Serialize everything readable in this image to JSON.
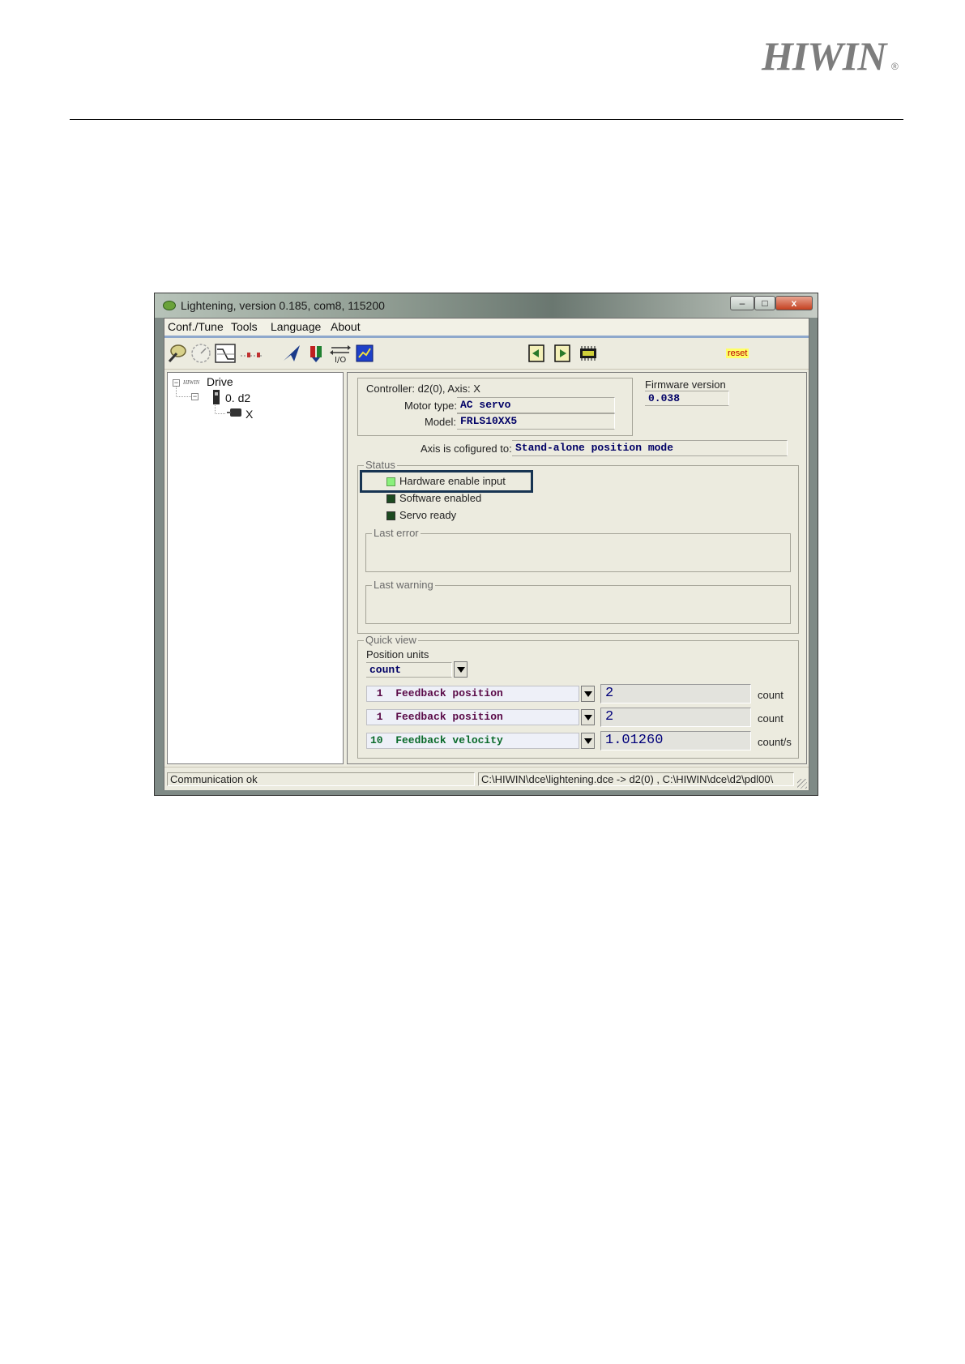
{
  "page": {
    "brand": "HIWIN",
    "registered_mark": "®"
  },
  "window": {
    "title": "Lightening, version 0.185, com8, 115200",
    "buttons": {
      "minimize": "–",
      "maximize": "□",
      "close": "x"
    },
    "menu": [
      "Conf./Tune",
      "Tools",
      "Language",
      "About"
    ],
    "toolbar": {
      "reset_label": "reset",
      "icons": [
        "wrench-icon",
        "scope-icon",
        "profile-icon",
        "io-signals-icon",
        "jet-icon",
        "polarity-icon",
        "io-icon",
        "chart-icon",
        "upload-icon",
        "download-icon",
        "flash-chip-icon"
      ]
    },
    "tree": {
      "root": "Drive",
      "root_logo": "HIWIN",
      "drive": "0. d2",
      "axis": "X"
    },
    "info": {
      "controller_label": "Controller: d2(0),  Axis: X",
      "motor_type_label": "Motor type:",
      "motor_type_value": "AC servo",
      "model_label": "Model:",
      "model_value": "FRLS10XX5",
      "firmware_label": "Firmware version",
      "firmware_value": "0.038",
      "axis_config_label": "Axis is cofigured to:",
      "axis_config_value": "Stand-alone position mode"
    },
    "status": {
      "group_label": "Status",
      "items": [
        {
          "label": "Hardware enable input",
          "state": "on"
        },
        {
          "label": "Software enabled",
          "state": "off"
        },
        {
          "label": "Servo ready",
          "state": "off"
        }
      ],
      "last_error_label": "Last error",
      "last_warning_label": "Last warning"
    },
    "quick_view": {
      "group_label": "Quick view",
      "position_units_label": "Position units",
      "position_units_value": "count",
      "rows": [
        {
          "selector": " 1  Feedback position",
          "value": "2",
          "unit": "count",
          "color": "#5a0a48"
        },
        {
          "selector": " 1  Feedback position",
          "value": "2",
          "unit": "count",
          "color": "#5a0a48"
        },
        {
          "selector": "10  Feedback velocity",
          "value": "1.01260",
          "unit": "count/s",
          "color": "#0a6a2a"
        }
      ]
    },
    "statusbar": {
      "left": "Communication ok",
      "right": "C:\\HIWIN\\dce\\lightening.dce -> d2(0) , C:\\HIWIN\\dce\\d2\\pdl00\\"
    }
  }
}
